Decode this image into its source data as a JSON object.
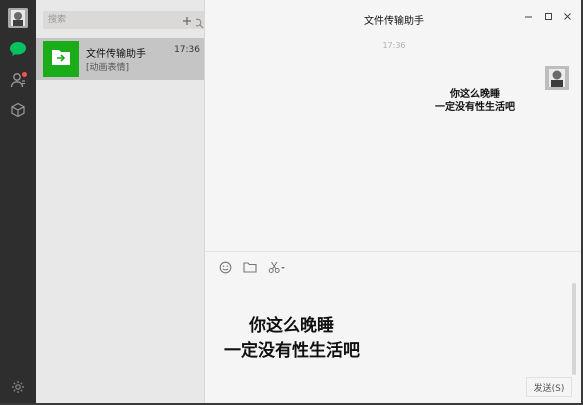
{
  "window": {
    "title": "文件传输助手",
    "minimize_icon": "minimize-icon",
    "maximize_icon": "maximize-icon",
    "close_icon": "close-icon"
  },
  "sidebar": {
    "items": [
      {
        "name": "avatar",
        "icon": "user-avatar"
      },
      {
        "name": "chats",
        "icon": "chat-bubble-icon",
        "active": true,
        "color": "#07c160"
      },
      {
        "name": "contacts",
        "icon": "contacts-icon",
        "has_badge": true
      },
      {
        "name": "favorites",
        "icon": "cube-icon"
      }
    ],
    "settings_icon": "gear-icon"
  },
  "search": {
    "placeholder": "搜索",
    "icon": "search-icon",
    "add_icon": "plus-icon"
  },
  "conversations": [
    {
      "name": "文件传输助手",
      "time": "17:36",
      "last_message": "[动画表情]",
      "icon": "file-transfer-icon",
      "color": "#1aad19"
    }
  ],
  "chat": {
    "timestamp": "17:36",
    "message": {
      "line1": "你这么晚睡",
      "line2": "一定没有性生活吧"
    },
    "toolbar": [
      "emoji-icon",
      "folder-icon",
      "scissors-icon"
    ],
    "compose": {
      "line1": "你这么晚睡",
      "line2": "一定没有性生活吧"
    },
    "send_label": "发送(S)"
  },
  "colors": {
    "rail": "#2e2e2e",
    "list_bg": "#e9e8e8",
    "selected_conv": "#c6c5c5",
    "chat_bg": "#f5f5f5",
    "accent": "#07c160"
  }
}
